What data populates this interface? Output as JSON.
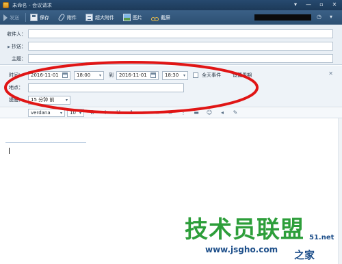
{
  "window": {
    "title": "未命名 - 会议请求",
    "controls": [
      "▾",
      "—",
      "▫",
      "✕"
    ]
  },
  "toolbar": {
    "send": "发送",
    "save": "保存",
    "attach": "附件",
    "big_attach": "超大附件",
    "image": "图片",
    "screenshot": "截屏",
    "right_icons": [
      "◷",
      "▾"
    ]
  },
  "header": {
    "to_label": "收件人：",
    "cc_label": "抄送：",
    "subject_label": "主题：",
    "expand_icon": "▶"
  },
  "meeting": {
    "time_label": "时间：",
    "start_date": "2016-11-01",
    "start_time": "18:00",
    "to_label": "到",
    "end_date": "2016-11-01",
    "end_time": "18:30",
    "all_day_label": "全天事件",
    "recurrence_label": "设置周期",
    "location_label": "地点：",
    "reminder_label": "提醒：",
    "reminder_value": "15 分钟 前",
    "close_icon": "✕"
  },
  "format": {
    "font": "verdana",
    "size": "10",
    "icons": [
      "B",
      "I",
      "U",
      "A",
      "≡",
      "≡",
      "≡",
      "⋮",
      "▬",
      "☺",
      "◂",
      "✎"
    ]
  },
  "watermark": {
    "main": "技术员联盟",
    "url": "www.jsgho.com",
    "small": "51.net",
    "house": "之家"
  },
  "colors": {
    "annotation": "#e01515",
    "toolbar": "#2f5477",
    "watermark_green": "#2d9e3a"
  }
}
